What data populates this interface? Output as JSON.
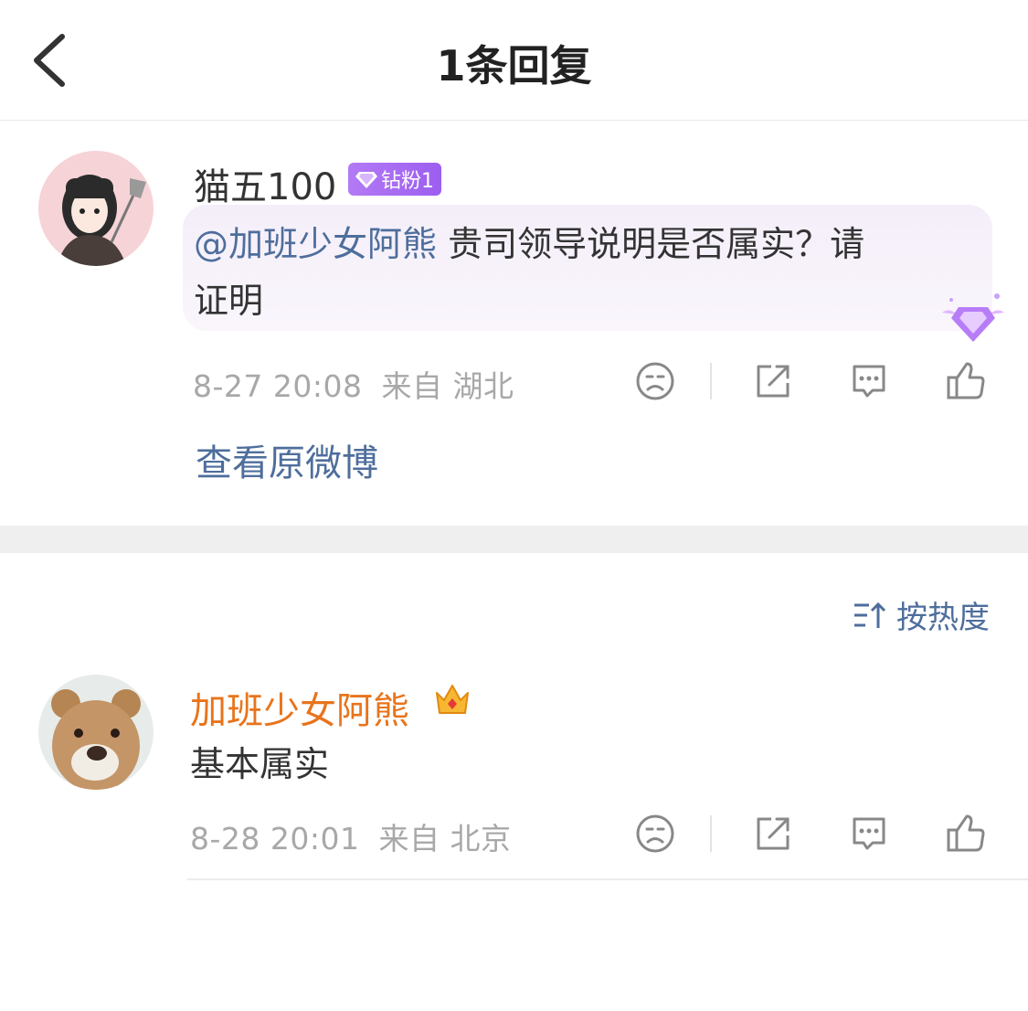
{
  "header": {
    "title": "1条回复"
  },
  "icons": {
    "back": "chevron-left-icon",
    "dislike": "sad-face-icon",
    "share": "share-icon",
    "comment": "comment-icon",
    "like": "thumbs-up-icon",
    "sort": "sort-icon"
  },
  "colors": {
    "link": "#4e6e9c",
    "orange_name": "#e8741c",
    "badge": "#a56af2",
    "meta": "#a8a8a8"
  },
  "main_comment": {
    "username": "猫五100",
    "badge": "钻粉1",
    "mention": "@加班少女阿熊",
    "text_line1": " 贵司领导说明是否属实？请",
    "text_line2": "证明",
    "time": "8-27 20:08",
    "source": "来自 湖北"
  },
  "view_original": "查看原微博",
  "sort_label": "按热度",
  "replies": [
    {
      "username": "加班少女阿熊",
      "text": "基本属实",
      "time": "8-28 20:01",
      "source": "来自 北京"
    }
  ]
}
